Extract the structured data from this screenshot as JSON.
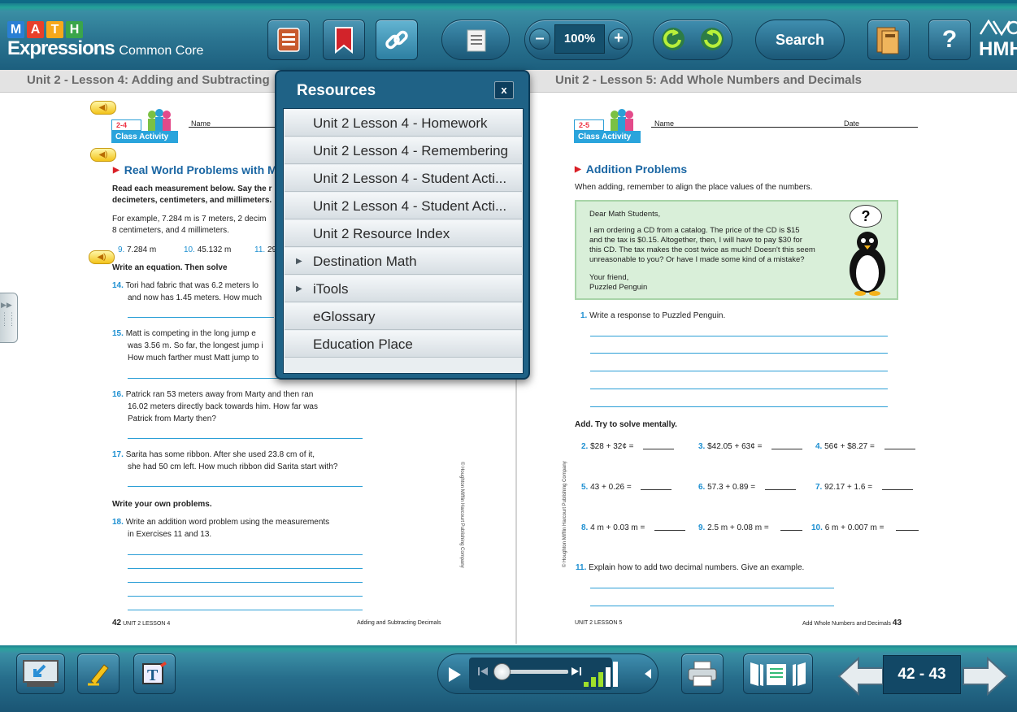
{
  "app": {
    "logo_letters": [
      "M",
      "A",
      "T",
      "H"
    ],
    "logo_colors": [
      "#2a7fd4",
      "#e8402a",
      "#f7a81b",
      "#3aa54a"
    ],
    "logo_word": "Expressions",
    "logo_sub": "Common Core",
    "publisher": "HMH"
  },
  "toolbar": {
    "toc_icon": "table-of-contents-icon",
    "bookmark_icon": "bookmark-icon",
    "resources_icon": "link-icon",
    "notes_icon": "notes-icon",
    "zoom_value": "100%",
    "zoom_out": "–",
    "zoom_in": "+",
    "undo_icon": "rotate-left-icon",
    "redo_icon": "rotate-right-icon",
    "search_label": "Search",
    "folder_icon": "folder-icon",
    "help_label": "?"
  },
  "titles": {
    "left": "Unit 2 - Lesson 4: Adding and Subtracting",
    "right": "Unit 2 - Lesson 5: Add Whole Numbers and Decimals"
  },
  "resources": {
    "title": "Resources",
    "close": "x",
    "items": [
      {
        "label": "Unit 2 Lesson 4 - Homework",
        "expandable": false
      },
      {
        "label": "Unit 2 Lesson 4 - Remembering",
        "expandable": false
      },
      {
        "label": "Unit 2 Lesson 4 - Student Acti...",
        "expandable": false
      },
      {
        "label": "Unit 2 Lesson 4 - Student Acti...",
        "expandable": false
      },
      {
        "label": "Unit 2 Resource Index",
        "expandable": false
      },
      {
        "label": "Destination Math",
        "expandable": true
      },
      {
        "label": "iTools",
        "expandable": true
      },
      {
        "label": "eGlossary",
        "expandable": false
      },
      {
        "label": "Education Place",
        "expandable": false
      }
    ]
  },
  "left_page": {
    "badge_num": "2-4",
    "badge_label": "Class Activity",
    "name_label": "Name",
    "heading": "Real World Problems with M",
    "intro1": "Read each measurement below. Say the r",
    "intro2": "decimeters, centimeters, and millimeters.",
    "example1": "For example, 7.284 m is 7 meters, 2 decim",
    "example2": "8 centimeters, and 4 millimeters.",
    "ex9_num": "9.",
    "ex9": "7.284 m",
    "ex10_num": "10.",
    "ex10": "45.132 m",
    "ex11_num": "11.",
    "ex11": "29",
    "write_eq": "Write an equation. Then solve",
    "p14_num": "14.",
    "p14a": "Tori had fabric that was 6.2 meters lo",
    "p14b": "and now has 1.45 meters. How much",
    "p15_num": "15.",
    "p15a": "Matt is competing in the long jump e",
    "p15b": "was 3.56 m. So far, the longest jump i",
    "p15c": "How much farther must Matt jump to",
    "p16_num": "16.",
    "p16a": "Patrick ran 53 meters away from Marty and then ran",
    "p16b": "16.02 meters directly back towards him. How far was",
    "p16c": "Patrick from Marty then?",
    "p17_num": "17.",
    "p17a": "Sarita has some ribbon. After she used 23.8 cm of it,",
    "p17b": "she had 50 cm left. How much ribbon did Sarita start with?",
    "own": "Write your own problems.",
    "p18_num": "18.",
    "p18a": "Write an addition word problem using the measurements",
    "p18b": "in Exercises 11 and 13.",
    "copyright": "© Houghton Mifflin Harcourt Publishing Company",
    "footer_num": "42",
    "footer_unit": "UNIT 2 LESSON 4",
    "footer_title": "Adding and Subtracting Decimals"
  },
  "right_page": {
    "badge_num": "2-5",
    "badge_label": "Class Activity",
    "name_label": "Name",
    "date_label": "Date",
    "heading": "Addition Problems",
    "intro": "When adding, remember to align the place values of the numbers.",
    "letter": {
      "greeting": "Dear Math Students,",
      "l1": "I am ordering a CD from a catalog. The price of the CD is $15",
      "l2": "and the tax is $0.15. Altogether, then, I will have to pay $30 for",
      "l3": "this CD. The tax makes the cost twice as much! Doesn't this seem",
      "l4": "unreasonable to you? Or have I made some kind of a mistake?",
      "closing": "Your friend,",
      "sign": "Puzzled Penguin",
      "thought": "?"
    },
    "q1_num": "1.",
    "q1": "Write a response to Puzzled Penguin.",
    "add_heading": "Add. Try to solve mentally.",
    "exercises": [
      {
        "num": "2.",
        "expr": "$28 + 32¢ ="
      },
      {
        "num": "3.",
        "expr": "$42.05 + 63¢ ="
      },
      {
        "num": "4.",
        "expr": "56¢ + $8.27 ="
      },
      {
        "num": "5.",
        "expr": "43 + 0.26 ="
      },
      {
        "num": "6.",
        "expr": "57.3 + 0.89 ="
      },
      {
        "num": "7.",
        "expr": "92.17 + 1.6 ="
      },
      {
        "num": "8.",
        "expr": "4 m + 0.03 m ="
      },
      {
        "num": "9.",
        "expr": "2.5 m + 0.08 m ="
      },
      {
        "num": "10.",
        "expr": "6 m + 0.007 m ="
      }
    ],
    "q11_num": "11.",
    "q11": "Explain how to add two decimal numbers. Give an example.",
    "copyright": "© Houghton Mifflin Harcourt Publishing Company",
    "footer_unit": "UNIT 2 LESSON 5",
    "footer_title": "Add Whole Numbers and Decimals",
    "footer_num": "43"
  },
  "bottom": {
    "page_display": "42 - 43",
    "exit_icon": "exit-whiteboard-icon",
    "highlighter_icon": "highlighter-icon",
    "text_tool_icon": "text-tool-icon",
    "play_icon": "play-icon",
    "print_icon": "print-icon",
    "pages_icon": "page-view-icon",
    "prev_icon": "arrow-left-icon",
    "next_icon": "arrow-right-icon",
    "audio_progress": 0.0
  }
}
